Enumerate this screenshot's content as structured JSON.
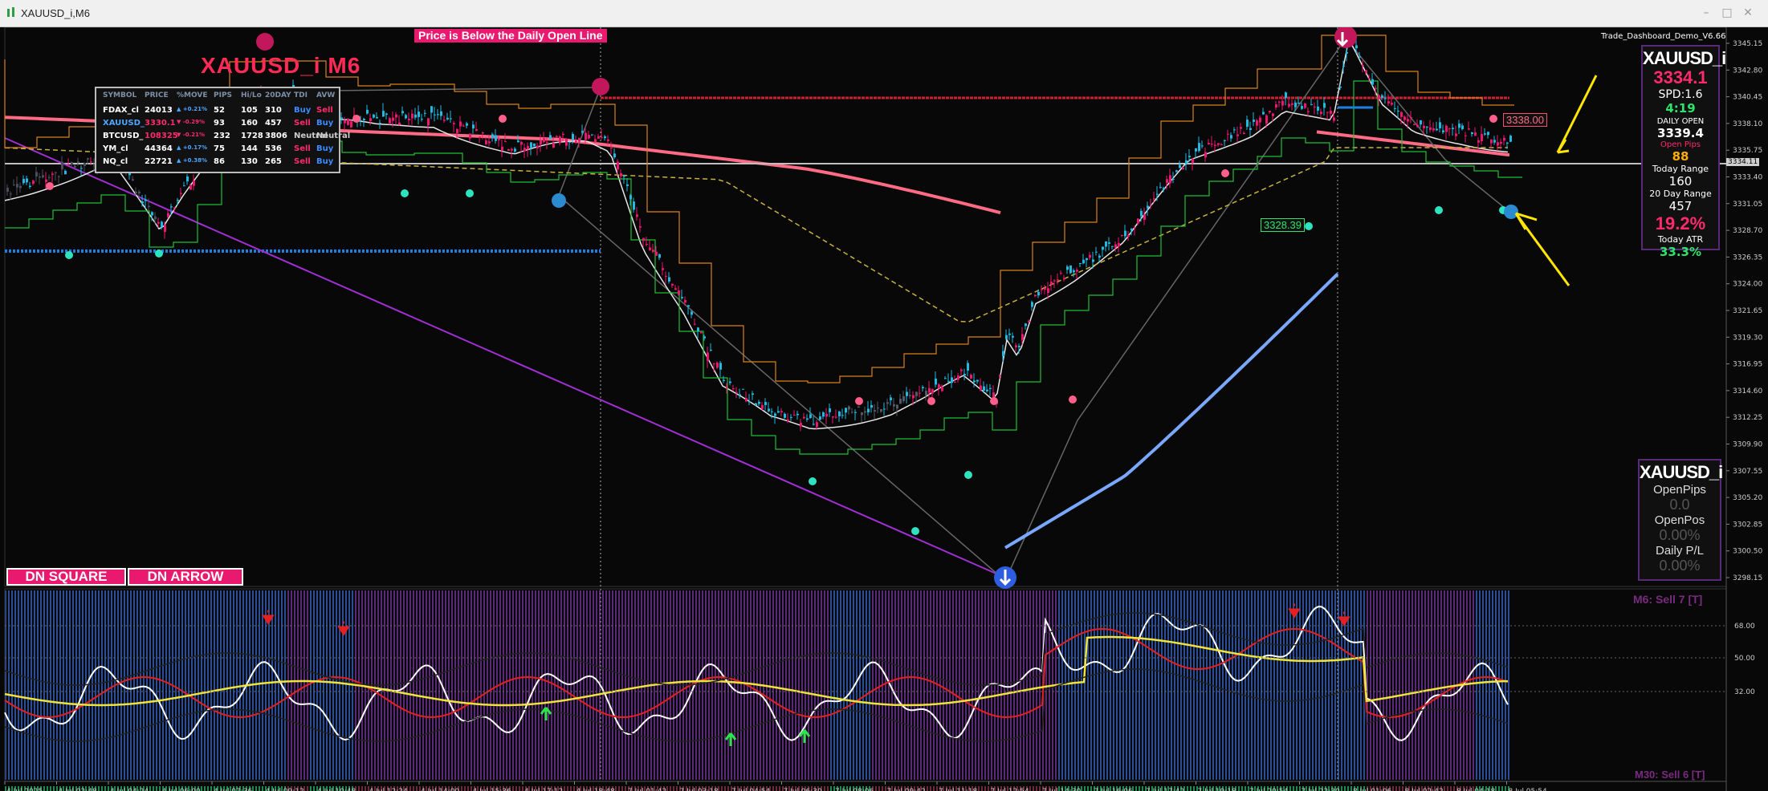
{
  "window": {
    "title": "XAUUSD_i,M6"
  },
  "chart": {
    "symbol_title": "XAUUSD_i M6",
    "alert_text": "Price is Below the Daily Open Line",
    "dashboard_name": "Trade_Dashboard_Demo_V6.66",
    "price_labels": [
      "3345.15",
      "3342.80",
      "3340.45",
      "3338.10",
      "3335.75",
      "3333.40",
      "3331.05",
      "3328.70",
      "3326.35",
      "3324.00",
      "3321.65",
      "3319.30",
      "3316.95",
      "3314.60",
      "3312.25",
      "3309.90",
      "3307.55",
      "3305.20",
      "3302.85",
      "3300.50",
      "3298.15"
    ],
    "current_price_tag": "3334.11",
    "level_label_1": "3338.00",
    "level_label_2": "3328.39",
    "buttons": {
      "dn_square": "DN SQUARE",
      "dn_arrow": "DN ARROW"
    },
    "time_labels": [
      "4 Jul 2025",
      "4 Jul 02:48",
      "4 Jul 04:24",
      "4 Jul 06:00",
      "4 Jul 07:36",
      "4 Jul 09:12",
      "4 Jul 10:48",
      "4 Jul 12:24",
      "4 Jul 14:00",
      "4 Jul 15:36",
      "4 Jul 17:12",
      "4 Jul 18:48",
      "7 Jul 01:42",
      "7 Jul 03:18",
      "7 Jul 04:54",
      "7 Jul 06:30",
      "7 Jul 08:06",
      "7 Jul 09:42",
      "7 Jul 11:18",
      "7 Jul 12:54",
      "7 Jul 14:30",
      "7 Jul 16:06",
      "7 Jul 17:42",
      "7 Jul 19:18",
      "7 Jul 20:54",
      "7 Jul 22:30",
      "8 Jul 01:06",
      "8 Jul 02:42",
      "8 Jul 04:18",
      "8 Jul 05:54"
    ]
  },
  "watchlist": {
    "headers": [
      "SYMBOL",
      "PRICE",
      "%MOVE",
      "PIPS",
      "Hi/Lo",
      "20DAY",
      "TDI",
      "AVW"
    ],
    "rows": [
      {
        "symbol": "FDAX_cl",
        "price": "24013",
        "move": "▲ +0.21%",
        "pips": "52",
        "hilo": "105",
        "day20": "310",
        "tdi": "Buy",
        "avw": "Sell",
        "symcolor": "#ffffff",
        "pricecolor": "#ffffff",
        "movecolor": "#4da6ff",
        "tdicolor": "#3d8bff",
        "avwcolor": "#ff2a6d"
      },
      {
        "symbol": "XAUUSD_",
        "price": "3330.1",
        "move": "▼ -0.29%",
        "pips": "93",
        "hilo": "160",
        "day20": "457",
        "tdi": "Sell",
        "avw": "Buy",
        "symcolor": "#4da6ff",
        "pricecolor": "#ff2a6d",
        "movecolor": "#ff2a6d",
        "tdicolor": "#ff2a6d",
        "avwcolor": "#3d8bff"
      },
      {
        "symbol": "BTCUSD_",
        "price": "108325",
        "move": "▼ -0.21%",
        "pips": "232",
        "hilo": "1728",
        "day20": "3806",
        "tdi": "Neutral",
        "avw": "Neutral",
        "symcolor": "#ffffff",
        "pricecolor": "#ff2a6d",
        "movecolor": "#ff2a6d",
        "tdicolor": "#cccccc",
        "avwcolor": "#cccccc"
      },
      {
        "symbol": "YM_cl",
        "price": "44364",
        "move": "▲ +0.17%",
        "pips": "75",
        "hilo": "144",
        "day20": "536",
        "tdi": "Sell",
        "avw": "Buy",
        "symcolor": "#ffffff",
        "pricecolor": "#ffffff",
        "movecolor": "#4da6ff",
        "tdicolor": "#ff2a6d",
        "avwcolor": "#3d8bff"
      },
      {
        "symbol": "NQ_cl",
        "price": "22721",
        "move": "▲ +0.38%",
        "pips": "86",
        "hilo": "130",
        "day20": "265",
        "tdi": "Sell",
        "avw": "Buy",
        "symcolor": "#ffffff",
        "pricecolor": "#ffffff",
        "movecolor": "#4da6ff",
        "tdicolor": "#ff2a6d",
        "avwcolor": "#3d8bff"
      }
    ]
  },
  "dashboard": {
    "symbol": "XAUUSD_i",
    "price": "3334.1",
    "spread": "SPD:1.6",
    "timer": "4:19",
    "daily_open_label": "DAILY OPEN",
    "daily_open_value": "3339.4",
    "open_pips_label": "Open Pips",
    "open_pips_value": "88",
    "today_range_label": "Today Range",
    "today_range_value": "160",
    "day20_range_label": "20 Day Range",
    "day20_range_value": "457",
    "percent": "19.2%",
    "today_atr_label": "Today ATR",
    "today_atr_value": "33.3%"
  },
  "positions": {
    "symbol": "XAUUSD_i",
    "open_pips_label": "OpenPips",
    "open_pips_value": "0.0",
    "open_pos_label": "OpenPos",
    "open_pos_value": "0.00%",
    "daily_pl_label": "Daily P/L",
    "daily_pl_value": "0.00%"
  },
  "indicator": {
    "top_label": "M6: Sell 7 [T]",
    "bottom_label": "M30: Sell 6 [T]",
    "levels": [
      "68.00",
      "50.00",
      "32.00"
    ]
  },
  "colors": {
    "bull": "#22b8e0",
    "bear": "#e8196e",
    "dashboard_border": "#5a2a7a",
    "accent_yellow": "#ffe600"
  }
}
